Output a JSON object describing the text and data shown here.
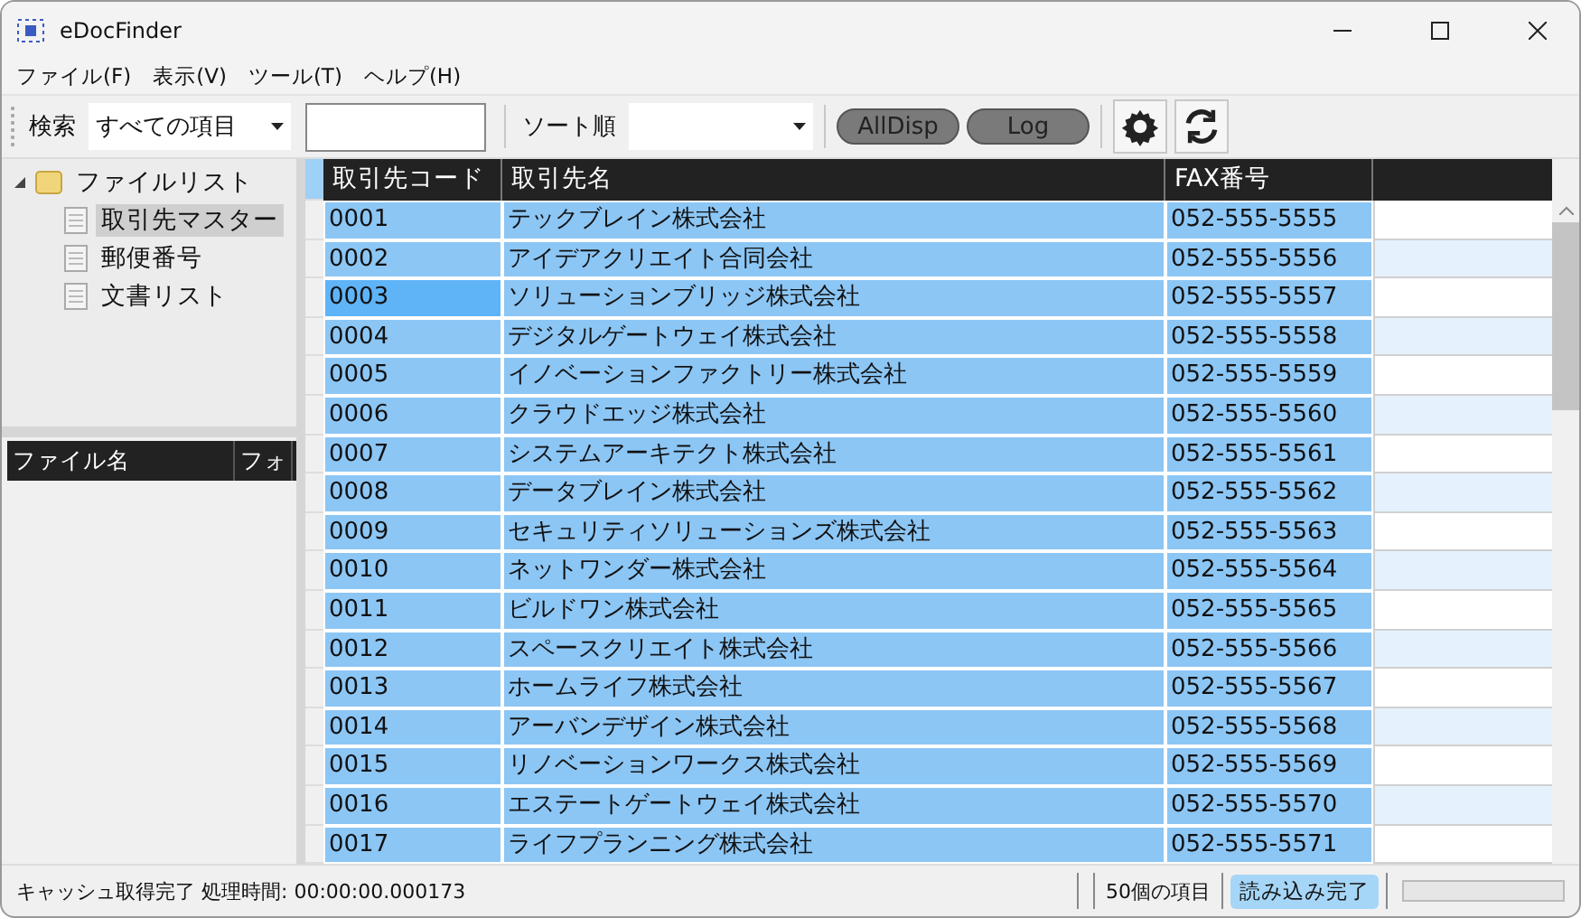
{
  "window": {
    "title": "eDocFinder"
  },
  "menu": [
    "ファイル(F)",
    "表示(V)",
    "ツール(T)",
    "ヘルプ(H)"
  ],
  "toolbar": {
    "search_label": "検索",
    "search_scope": "すべての項目",
    "sort_label": "ソート順",
    "buttons": [
      "AllDisp",
      "Log"
    ]
  },
  "tree": [
    {
      "label": "ファイルリスト",
      "expanded": true,
      "children": [
        {
          "label": "取引先マスター",
          "selected": true
        },
        {
          "label": "郵便番号",
          "selected": false
        },
        {
          "label": "文書リスト",
          "selected": false
        }
      ]
    }
  ],
  "file_list": {
    "columns": [
      "ファイル名",
      "フォ"
    ]
  },
  "table": {
    "columns": [
      "取引先コード",
      "取引先名",
      "FAX番号"
    ],
    "rows": [
      {
        "code": "0001",
        "name": "テックブレイン株式会社",
        "fax": "052-555-5555",
        "selected": true,
        "current": false
      },
      {
        "code": "0002",
        "name": "アイデアクリエイト合同会社",
        "fax": "052-555-5556",
        "selected": true,
        "current": false
      },
      {
        "code": "0003",
        "name": "ソリューションブリッジ株式会社",
        "fax": "052-555-5557",
        "selected": true,
        "current": true
      },
      {
        "code": "0004",
        "name": "デジタルゲートウェイ株式会社",
        "fax": "052-555-5558",
        "selected": true,
        "current": false
      },
      {
        "code": "0005",
        "name": "イノベーションファクトリー株式会社",
        "fax": "052-555-5559",
        "selected": true,
        "current": false
      },
      {
        "code": "0006",
        "name": "クラウドエッジ株式会社",
        "fax": "052-555-5560",
        "selected": true,
        "current": false
      },
      {
        "code": "0007",
        "name": "システムアーキテクト株式会社",
        "fax": "052-555-5561",
        "selected": true,
        "current": false
      },
      {
        "code": "0008",
        "name": "データブレイン株式会社",
        "fax": "052-555-5562",
        "selected": true,
        "current": false
      },
      {
        "code": "0009",
        "name": "セキュリティソリューションズ株式会社",
        "fax": "052-555-5563",
        "selected": true,
        "current": false
      },
      {
        "code": "0010",
        "name": "ネットワンダー株式会社",
        "fax": "052-555-5564",
        "selected": true,
        "current": false
      },
      {
        "code": "0011",
        "name": "ビルドワン株式会社",
        "fax": "052-555-5565",
        "selected": true,
        "current": false
      },
      {
        "code": "0012",
        "name": "スペースクリエイト株式会社",
        "fax": "052-555-5566",
        "selected": true,
        "current": false
      },
      {
        "code": "0013",
        "name": "ホームライフ株式会社",
        "fax": "052-555-5567",
        "selected": true,
        "current": false
      },
      {
        "code": "0014",
        "name": "アーバンデザイン株式会社",
        "fax": "052-555-5568",
        "selected": true,
        "current": false
      },
      {
        "code": "0015",
        "name": "リノベーションワークス株式会社",
        "fax": "052-555-5569",
        "selected": true,
        "current": false
      },
      {
        "code": "0016",
        "name": "エステートゲートウェイ株式会社",
        "fax": "052-555-5570",
        "selected": true,
        "current": false
      },
      {
        "code": "0017",
        "name": "ライフプランニング株式会社",
        "fax": "052-555-5571",
        "selected": true,
        "current": false
      }
    ]
  },
  "status_bar": {
    "message": "キャッシュ取得完了 処理時間: 00:00:00.000173",
    "count": "50個の項目",
    "badge": "読み込み完了",
    "progress": {
      "level": 0
    }
  }
}
